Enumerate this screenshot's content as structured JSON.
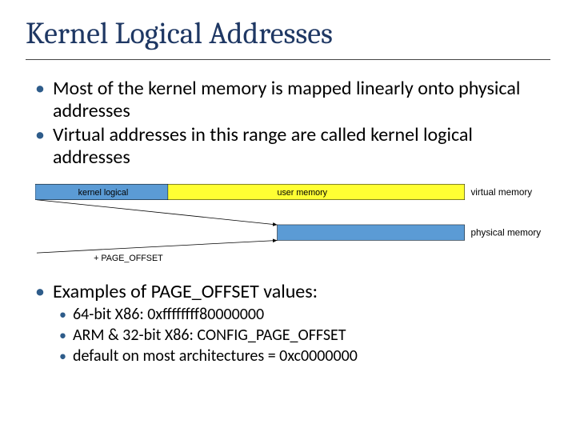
{
  "title": "Kernel Logical Addresses",
  "bullets_top": [
    "Most of the kernel memory is mapped linearly onto physical addresses",
    "Virtual addresses in this range are called kernel logical addresses"
  ],
  "diagram": {
    "kernel_logical_label": "kernel logical",
    "user_memory_label": "user memory",
    "virtual_memory_label": "virtual memory",
    "physical_memory_label": "physical memory",
    "page_offset_label": "+ PAGE_OFFSET"
  },
  "examples_heading": "Examples of PAGE_OFFSET values:",
  "examples": [
    "64-bit X86: 0xffffffff80000000",
    "ARM & 32-bit X86: CONFIG_PAGE_OFFSET",
    "default on most architectures = 0xc0000000"
  ]
}
